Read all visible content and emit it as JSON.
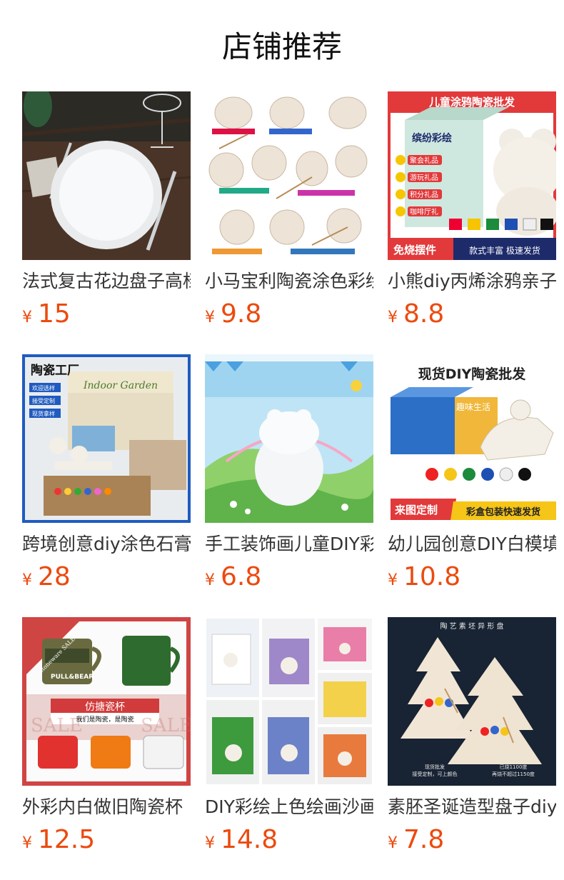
{
  "header": {
    "title": "店铺推荐"
  },
  "currency": "¥",
  "products": [
    {
      "name": "法式复古花边盘子高档",
      "price": "15"
    },
    {
      "name": "小马宝利陶瓷涂色彩绘",
      "price": "9.8"
    },
    {
      "name": "小熊diy丙烯涂鸦亲子",
      "price": "8.8",
      "overlay": {
        "banner": "儿童涂鸦陶瓷批发",
        "box": "缤纷彩绘",
        "tags": [
          "聚会礼品",
          "游玩礼品",
          "积分礼品",
          "咖啡厅礼"
        ],
        "left_bottom": "免烧摆件",
        "right_bottom": "款式丰富 极速发货"
      }
    },
    {
      "name": "跨境创意diy涂色石膏",
      "price": "28",
      "overlay": {
        "corner": "陶瓷工厂",
        "tags": [
          "欢迎选样",
          "接受定制",
          "现货拿样"
        ],
        "box": "Indoor Garden"
      }
    },
    {
      "name": "手工装饰画儿童DIY彩",
      "price": "6.8"
    },
    {
      "name": "幼儿园创意DIY白模填",
      "price": "10.8",
      "overlay": {
        "top": "现货DIY陶瓷批发",
        "box": "趣味生活",
        "left_bottom": "来图定制",
        "right_bottom": "彩盒包装快速发货"
      }
    },
    {
      "name": "外彩内白做旧陶瓷杯",
      "price": "12.5",
      "overlay": {
        "ribbon": "stoneware SALE",
        "mug": "PULL&BEAR",
        "banner": "仿搪瓷杯",
        "sub": "我们是陶瓷，是陶瓷",
        "bg": "SALE"
      }
    },
    {
      "name": "DIY彩绘上色绘画沙画",
      "price": "14.8"
    },
    {
      "name": "素胚圣诞造型盘子diy",
      "price": "7.8",
      "overlay": {
        "top": "陶 艺 素 坯 异 形 盘",
        "left": "现货批发",
        "left2": "接受定制，可上颜色",
        "right": "已烧1100度",
        "right2": "再烧不超过1150度"
      }
    }
  ],
  "colors": {
    "price": "#ec4a0e",
    "text": "#333333",
    "accent_red": "#e2393b",
    "accent_blue": "#1f5bc0"
  }
}
